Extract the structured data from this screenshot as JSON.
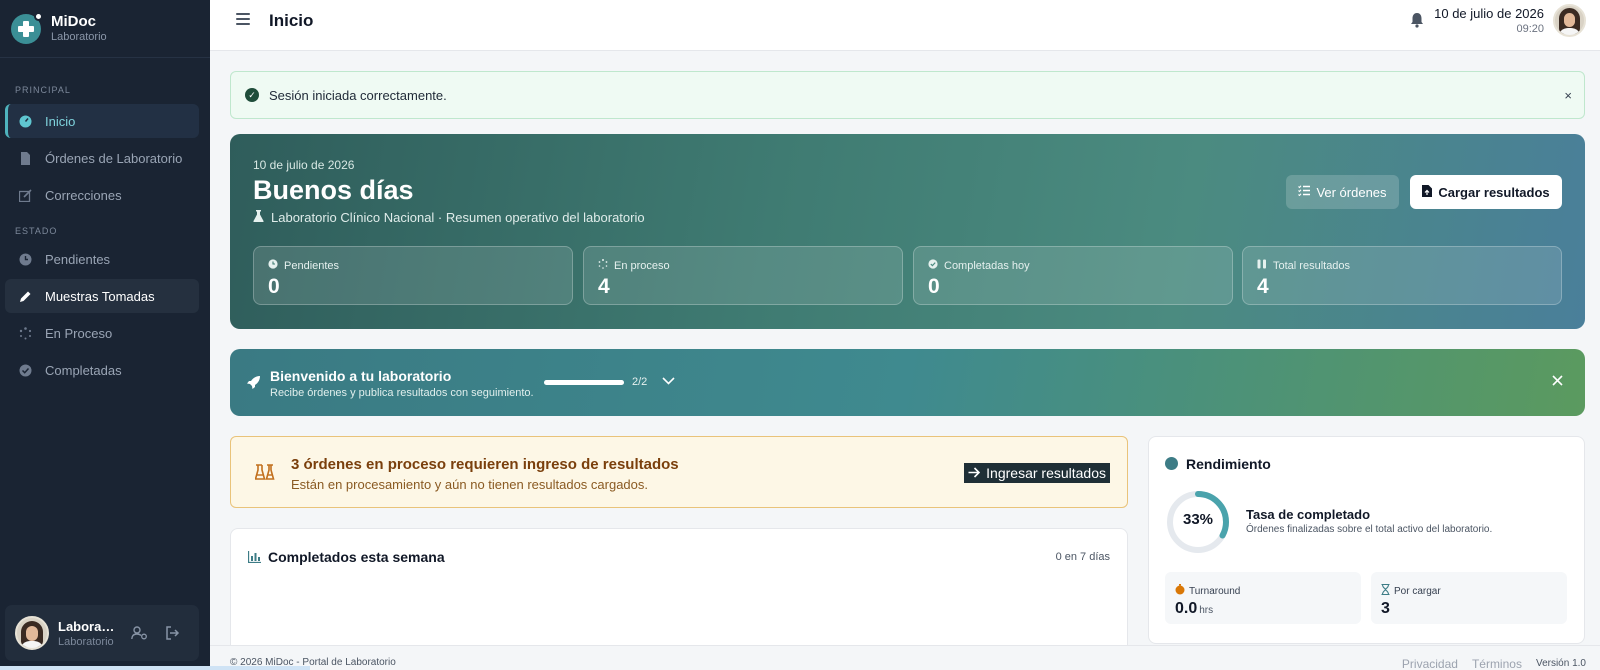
{
  "brand": {
    "name": "MiDoc",
    "subtitle": "Laboratorio"
  },
  "sidebar": {
    "section_principal": "PRINCIPAL",
    "section_estado": "ESTADO",
    "items_principal": [
      {
        "label": "Inicio",
        "icon": "dashboard-icon",
        "active": true
      },
      {
        "label": "Órdenes de Laboratorio",
        "icon": "file-icon"
      },
      {
        "label": "Correcciones",
        "icon": "edit-icon"
      }
    ],
    "items_estado": [
      {
        "label": "Pendientes",
        "icon": "clock-icon"
      },
      {
        "label": "Muestras Tomadas",
        "icon": "pen-icon",
        "hover": true
      },
      {
        "label": "En Proceso",
        "icon": "spinner-icon"
      },
      {
        "label": "Completadas",
        "icon": "check-circle-icon"
      }
    ],
    "user": {
      "name": "Laboratorio",
      "role": "Laboratorio"
    }
  },
  "topbar": {
    "title": "Inicio",
    "date": "10 de julio de 2026",
    "time": "09:20"
  },
  "alert": {
    "text": "Sesión iniciada correctamente.",
    "close": "×"
  },
  "hero": {
    "date": "10 de julio de 2026",
    "greeting": "Buenos días",
    "subtitle": "Laboratorio Clínico Nacional · Resumen operativo del laboratorio",
    "btn_orders": "Ver órdenes",
    "btn_upload": "Cargar resultados",
    "stats": [
      {
        "label": "Pendientes",
        "value": "0",
        "icon": "clock-icon"
      },
      {
        "label": "En proceso",
        "value": "4",
        "icon": "spinner-icon"
      },
      {
        "label": "Completadas hoy",
        "value": "0",
        "icon": "check-circle-icon"
      },
      {
        "label": "Total resultados",
        "value": "4",
        "icon": "flask-icon"
      }
    ]
  },
  "onboarding": {
    "title": "Bienvenido a tu laboratorio",
    "subtitle": "Recibe órdenes y publica resultados con seguimiento.",
    "progress_text": "2/2",
    "progress_fraction": 1.0
  },
  "warning": {
    "title": "3 órdenes en proceso requieren ingreso de resultados",
    "subtitle": "Están en procesamiento y aún no tienen resultados cargados.",
    "button": "Ingresar resultados"
  },
  "week": {
    "title": "Completados esta semana",
    "meta": "0 en 7 días"
  },
  "performance": {
    "title": "Rendimiento",
    "percent": "33%",
    "percent_value": 0.33,
    "rate_title": "Tasa de completado",
    "rate_sub": "Órdenes finalizadas sobre el total activo del laboratorio.",
    "turnaround_label": "Turnaround",
    "turnaround_value": "0.0",
    "turnaround_unit": "hrs",
    "pending_label": "Por cargar",
    "pending_value": "3"
  },
  "footer": {
    "copyright": "© 2026 MiDoc - Portal de Laboratorio",
    "privacy": "Privacidad",
    "terms": "Términos",
    "version": "Versión 1.0"
  },
  "colors": {
    "sidebar": "#1a2433",
    "accent": "#4fb3bd",
    "hero_start": "#2f5d5b",
    "warning_bg": "#fdf7e6"
  }
}
